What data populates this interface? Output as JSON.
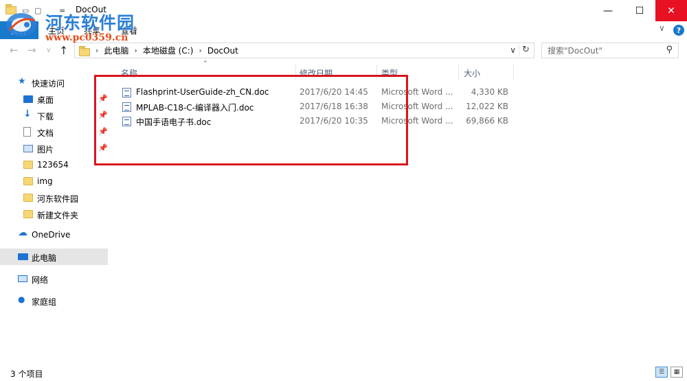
{
  "window": {
    "title": "DocOut",
    "minimize": "—",
    "maximize": "☐",
    "close": "✕"
  },
  "watermark": {
    "title": "河东软件园",
    "url": "www.pc0359.cn"
  },
  "ribbon": {
    "tabs": [
      "文件",
      "主页",
      "共享",
      "查看"
    ],
    "help": "?",
    "collapse": "∨"
  },
  "address": {
    "crumbs": [
      "此电脑",
      "本地磁盘 (C:)",
      "DocOut"
    ],
    "search_placeholder": "搜索\"DocOut\""
  },
  "sidebar": {
    "quick_access": "快速访问",
    "items": [
      {
        "label": "桌面",
        "icon": "desktop-icon",
        "pinned": true
      },
      {
        "label": "下载",
        "icon": "download-icon",
        "pinned": true
      },
      {
        "label": "文档",
        "icon": "document-icon",
        "pinned": true
      },
      {
        "label": "图片",
        "icon": "pictures-icon",
        "pinned": true
      },
      {
        "label": "123654",
        "icon": "folder-icon",
        "pinned": false
      },
      {
        "label": "img",
        "icon": "folder-icon",
        "pinned": false
      },
      {
        "label": "河东软件园",
        "icon": "folder-icon",
        "pinned": false
      },
      {
        "label": "新建文件夹",
        "icon": "folder-icon",
        "pinned": false
      }
    ],
    "onedrive": "OneDrive",
    "this_pc": "此电脑",
    "network": "网络",
    "homegroup": "家庭组"
  },
  "columns": {
    "name": "名称",
    "date": "修改日期",
    "type": "类型",
    "size": "大小"
  },
  "files": [
    {
      "name": "Flashprint-UserGuide-zh_CN.doc",
      "date": "2017/6/20 14:45",
      "type": "Microsoft Word ...",
      "size": "4,330 KB"
    },
    {
      "name": "MPLAB-C18-C-编译器入门.doc",
      "date": "2017/6/18 16:38",
      "type": "Microsoft Word ...",
      "size": "12,022 KB"
    },
    {
      "name": "中国手语电子书.doc",
      "date": "2017/6/20 10:35",
      "type": "Microsoft Word ...",
      "size": "69,866 KB"
    }
  ],
  "status": {
    "count": "3 个项目"
  },
  "colors": {
    "accent": "#1979ca",
    "highlight": "#d8141d",
    "close": "#e81123"
  }
}
